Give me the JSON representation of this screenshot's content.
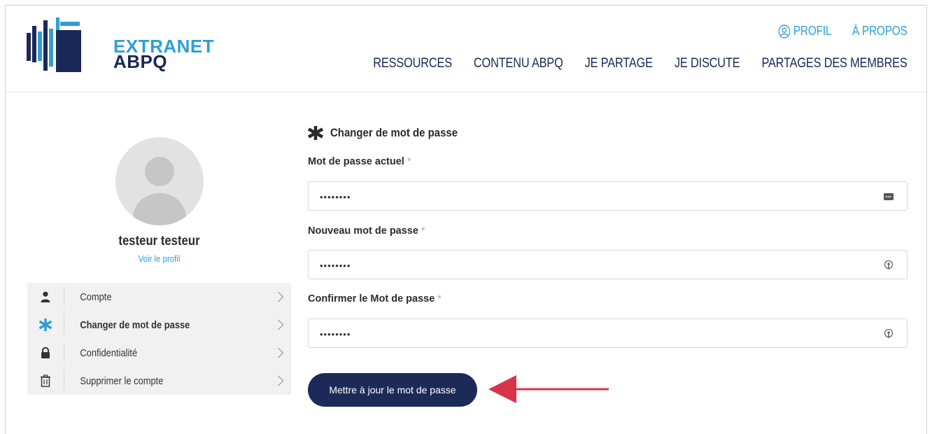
{
  "brand": {
    "line1": "EXTRANET",
    "line2": "ABPQ",
    "colors": {
      "light_blue": "#2d9fd6",
      "navy": "#1a2857"
    }
  },
  "topnav": {
    "profile_label": "PROFIL",
    "about_label": "À PROPOS"
  },
  "mainnav": {
    "items": [
      {
        "label": "RESSOURCES"
      },
      {
        "label": "CONTENU ABPQ"
      },
      {
        "label": "JE PARTAGE"
      },
      {
        "label": "JE DISCUTE"
      },
      {
        "label": "PARTAGES DES MEMBRES"
      }
    ]
  },
  "profile": {
    "name": "testeur testeur",
    "view_profile": "Voir le profil"
  },
  "sidebar": {
    "items": [
      {
        "label": "Compte",
        "icon": "user-icon"
      },
      {
        "label": "Changer de mot de passe",
        "icon": "asterisk-icon",
        "active": true
      },
      {
        "label": "Confidentialité",
        "icon": "lock-icon"
      },
      {
        "label": "Supprimer le compte",
        "icon": "trash-icon"
      }
    ]
  },
  "form": {
    "title": "Changer de mot de passe",
    "current": {
      "label": "Mot de passe actuel",
      "value": "••••••••"
    },
    "new": {
      "label": "Nouveau mot de passe",
      "value": "••••••••"
    },
    "confirm": {
      "label": "Confirmer le Mot de passe",
      "value": "••••••••"
    },
    "required_mark": "*",
    "submit_label": "Mettre à jour le mot de passe"
  },
  "annotation": {
    "arrow_color": "#d9334a"
  }
}
